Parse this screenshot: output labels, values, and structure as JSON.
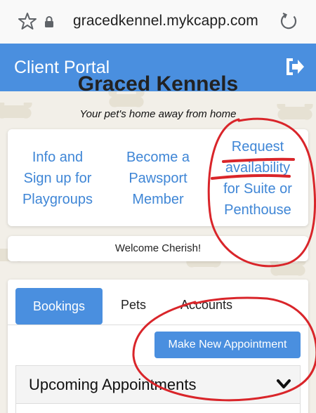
{
  "browser": {
    "url": "gracedkennel.mykcapp.com",
    "icons": [
      "star-icon",
      "lock-icon",
      "reload-icon"
    ]
  },
  "header": {
    "title": "Client Portal",
    "logout_icon": "logout-icon",
    "color": "#4a8fdf"
  },
  "brand": {
    "name": "Graced Kennels",
    "tagline": "Your pet's home away from home"
  },
  "links": [
    {
      "line1": "Info and",
      "line2": "Sign up for",
      "line3": "Playgroups"
    },
    {
      "line1": "Become a",
      "line2": "Pawsport",
      "line3": "Member"
    },
    {
      "line1": "Request",
      "line2": "availability",
      "line3": "for Suite or",
      "line4": "Penthouse"
    }
  ],
  "welcome": "Welcome Cherish!",
  "tabs": {
    "items": [
      "Bookings",
      "Pets",
      "Accounts"
    ],
    "active": "Bookings"
  },
  "actions": {
    "new_appointment": "Make New Appointment"
  },
  "upcoming": {
    "title": "Upcoming Appointments",
    "chevron_icon": "chevron-down-icon"
  },
  "colors": {
    "accent": "#4a8fdf",
    "link": "#3f86d6",
    "annotation": "#d9252a"
  }
}
